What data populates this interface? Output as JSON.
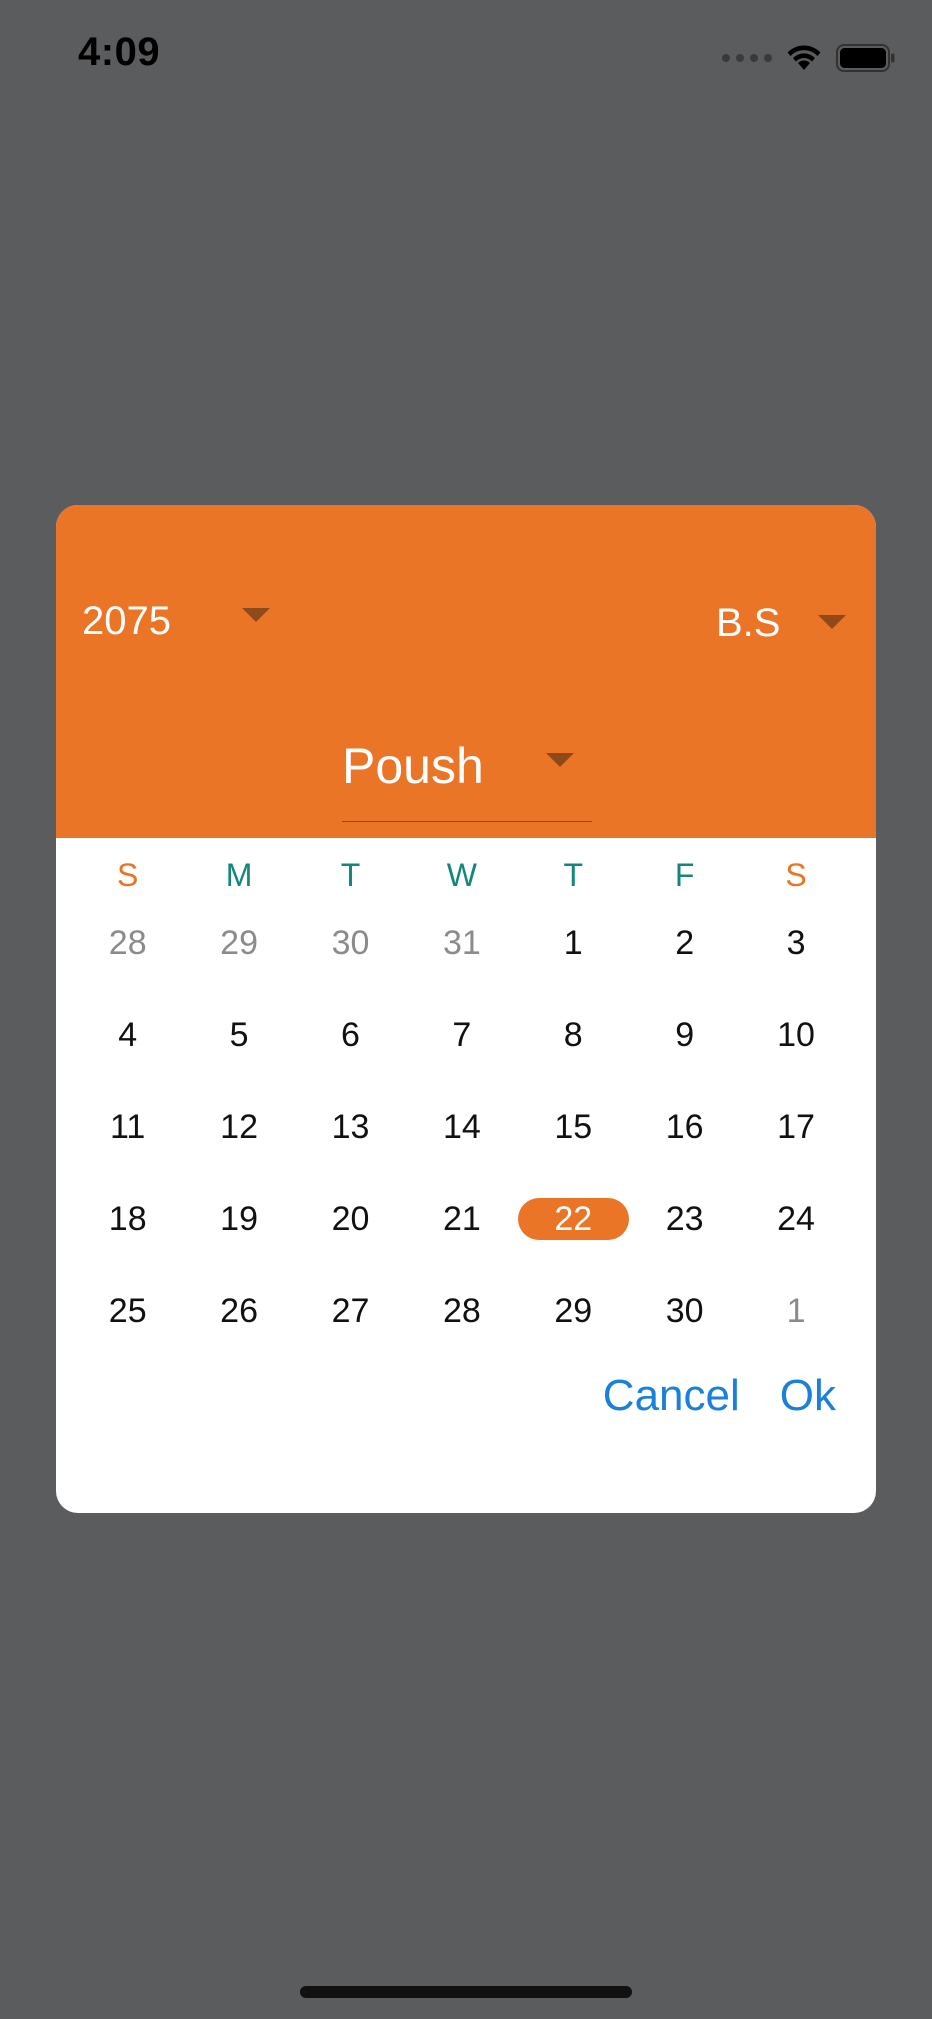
{
  "status_bar": {
    "time": "4:09",
    "signal_icon": "signal-dots-icon",
    "wifi_icon": "wifi-icon",
    "battery_icon": "battery-icon"
  },
  "dialog": {
    "accent_color": "#ea7526",
    "header": {
      "year": "2075",
      "era": "B.S",
      "month": "Poush"
    },
    "weekdays": [
      "S",
      "M",
      "T",
      "W",
      "T",
      "F",
      "S"
    ],
    "weeks": [
      [
        {
          "d": "28",
          "muted": true
        },
        {
          "d": "29",
          "muted": true
        },
        {
          "d": "30",
          "muted": true
        },
        {
          "d": "31",
          "muted": true
        },
        {
          "d": "1"
        },
        {
          "d": "2"
        },
        {
          "d": "3"
        }
      ],
      [
        {
          "d": "4"
        },
        {
          "d": "5"
        },
        {
          "d": "6"
        },
        {
          "d": "7"
        },
        {
          "d": "8"
        },
        {
          "d": "9"
        },
        {
          "d": "10"
        }
      ],
      [
        {
          "d": "11"
        },
        {
          "d": "12"
        },
        {
          "d": "13"
        },
        {
          "d": "14"
        },
        {
          "d": "15"
        },
        {
          "d": "16"
        },
        {
          "d": "17"
        }
      ],
      [
        {
          "d": "18"
        },
        {
          "d": "19"
        },
        {
          "d": "20"
        },
        {
          "d": "21"
        },
        {
          "d": "22",
          "selected": true
        },
        {
          "d": "23"
        },
        {
          "d": "24"
        }
      ],
      [
        {
          "d": "25"
        },
        {
          "d": "26"
        },
        {
          "d": "27"
        },
        {
          "d": "28"
        },
        {
          "d": "29"
        },
        {
          "d": "30"
        },
        {
          "d": "1",
          "muted": true
        }
      ]
    ],
    "actions": {
      "cancel_label": "Cancel",
      "ok_label": "Ok",
      "link_color": "#1a80d9"
    }
  }
}
